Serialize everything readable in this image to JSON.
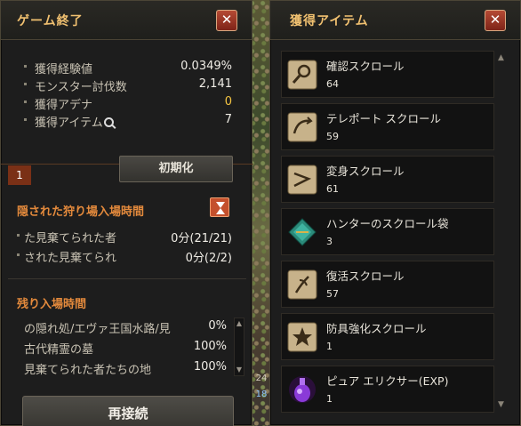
{
  "left_window": {
    "title": "ゲーム終了",
    "close_glyph": "✕",
    "stats": [
      {
        "label": "獲得経験値",
        "value": "0.0349%"
      },
      {
        "label": "モンスター討伐数",
        "value": "2,141"
      },
      {
        "label": "獲得アデナ",
        "value": "0"
      },
      {
        "label": "獲得アイテム",
        "value": "7"
      }
    ],
    "tab_number": "1",
    "reset_button": "初期化",
    "hidden_section": {
      "title": "隠された狩り場入場時間",
      "rows": [
        {
          "label": "た見棄てられた者",
          "value": "0分(21/21)"
        },
        {
          "label": "された見棄てられ",
          "value": "0分(2/2)"
        }
      ]
    },
    "remaining_section": {
      "title": "残り入場時間",
      "rows": [
        {
          "label": "の隠れ処/エヴァ王国水路/見",
          "value": "0%"
        },
        {
          "label": "古代精霊の墓",
          "value": "100%"
        },
        {
          "label": "見棄てられた者たちの地",
          "value": "100%"
        }
      ]
    },
    "reconnect_button": "再接続"
  },
  "background_tags": [
    "24",
    "18"
  ],
  "right_window": {
    "title": "獲得アイテム",
    "close_glyph": "✕",
    "items": [
      {
        "name": "確認スクロール",
        "count": "64",
        "icon": "scroll-magnify-icon"
      },
      {
        "name": "テレポート スクロール",
        "count": "59",
        "icon": "scroll-teleport-icon"
      },
      {
        "name": "変身スクロール",
        "count": "61",
        "icon": "scroll-transform-icon"
      },
      {
        "name": "ハンターのスクロール袋",
        "count": "3",
        "icon": "scroll-pouch-icon"
      },
      {
        "name": "復活スクロール",
        "count": "57",
        "icon": "scroll-resurrect-icon"
      },
      {
        "name": "防具強化スクロール",
        "count": "1",
        "icon": "scroll-armor-icon"
      },
      {
        "name": "ピュア エリクサー(EXP)",
        "count": "1",
        "icon": "elixir-icon"
      }
    ]
  },
  "colors": {
    "title_gold": "#f0c070",
    "section_orange": "#e48a3c",
    "adena_gold": "#f5c542",
    "close_red": "#9e3322"
  }
}
